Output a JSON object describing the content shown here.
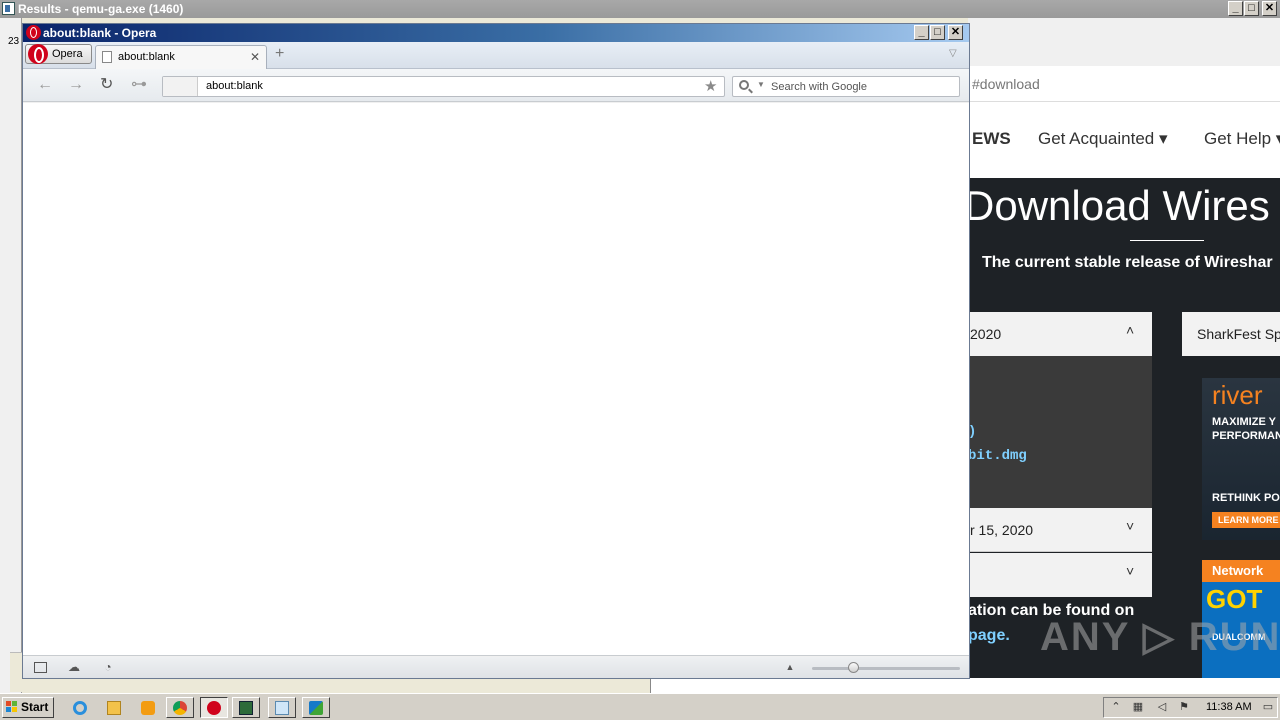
{
  "results_window": {
    "title": "Results - qemu-ga.exe (1460)",
    "side_stub": "23",
    "controls": [
      "_",
      "□",
      "✕"
    ]
  },
  "website": {
    "url_fragment": "#download",
    "nav_news": "EWS",
    "nav_get_acquainted": "Get Acquainted ▾",
    "nav_get_help": "Get Help ▾",
    "hero_title": "Download Wires",
    "hero_subtitle": "The current stable release of Wireshar",
    "panel1_text": "2020",
    "panel1_chevron": "˄",
    "link1": ")",
    "link2": "bit.dmg",
    "panel2_text": "r 15, 2020",
    "panel2_chevron": "˅",
    "panel3_chevron": "˅",
    "info_line1": "ation can be found on",
    "info_line2": "page.",
    "sharkfest_card": "SharkFest Sp",
    "ad1": {
      "brand": "river",
      "line1": "MAXIMIZE Y",
      "line2": "PERFORMAN",
      "line3": "RETHINK PO",
      "button": "LEARN MORE"
    },
    "ad2": {
      "header": "Network",
      "headline": "GOT",
      "footer": "DUALCOMM"
    },
    "watermark": "ANY ▷ RUN"
  },
  "opera": {
    "title": "about:blank - Opera",
    "controls": [
      "_",
      "□",
      "✕"
    ],
    "menu_label": "Opera",
    "tab_label": "about:blank",
    "tab_close": "✕",
    "new_tab": "+",
    "tab_menu": "▽",
    "back": "←",
    "forward": "→",
    "reload": "↻",
    "key": "⊶",
    "address_value": "about:blank",
    "bookmark_star": "★",
    "search_placeholder": "Search with Google",
    "search_dropdown": "▼",
    "status_up": "▲",
    "status_unite": "☁",
    "status_turbo": "◔",
    "zoom_level": 0.28
  },
  "taskbar": {
    "start_label": "Start",
    "clock": "11:38 AM",
    "items": [
      "ie-icon",
      "explorer-icon",
      "media-player-icon",
      "chrome-icon",
      "opera-icon",
      "process-icon",
      "notepad-icon",
      "wireshark-icon"
    ]
  }
}
